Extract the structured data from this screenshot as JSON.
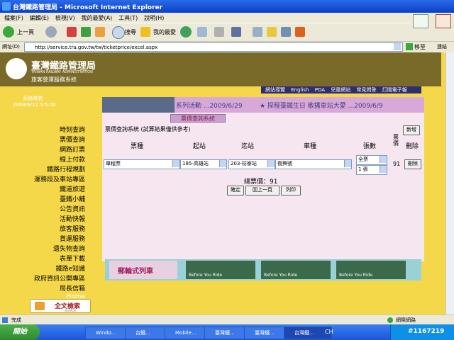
{
  "window": {
    "title": "台灣鐵路管理局 - Microsoft Internet Explorer"
  },
  "menu": [
    "檔案(F)",
    "編輯(E)",
    "檢視(V)",
    "我的最愛(A)",
    "工具(T)",
    "說明(H)"
  ],
  "toolbar": {
    "back": "上一頁",
    "search": "搜尋",
    "favorites": "我的最愛"
  },
  "address": {
    "label": "網址(D)",
    "url": "http://service.tra.gov.tw/tw/ticketprice/excel.aspx",
    "go": "移至",
    "links": "連結"
  },
  "site": {
    "logo_title": "臺灣鐵路管理局",
    "logo_subtitle": "TAIWAN RAILWAY ADMINISTRATION",
    "system_name": "旅客營運服務系統",
    "date_label": "系統時間",
    "date_value": "2009/6/12 5:5:00",
    "topnav": [
      "網站導覽",
      "English",
      "PDA",
      "兒童網站",
      "常見問答",
      "訂閱電子報"
    ]
  },
  "sidebar": [
    "時刻查詢",
    "票價查詢",
    "網路訂票",
    "線上付款",
    "鐵路行程規劃",
    "運務段及車站專區",
    "鐵道旅遊",
    "臺鐵小舖",
    "公告資訊",
    "活動快報",
    "旅客服務",
    "貨運服務",
    "遺失物查詢",
    "表單下載",
    "鐵路e知識",
    "政府資訊公開專區",
    "局長信箱",
    "Home"
  ],
  "search_button": {
    "label": "全文檢索",
    "sub": "SEARCH"
  },
  "banner": {
    "item1": "系列活動 ...2009/6/29",
    "item2": "★ 探程臺鐵生日 散播車站大愛 ...2009/6/9"
  },
  "form": {
    "tab": "票價查詢系統",
    "subtitle": "票價查詢系統 (試算結果僅供參考)",
    "new_button": "新增",
    "headers": [
      "票種",
      "起站",
      "迄站",
      "車種",
      "張數",
      "票價",
      "刪除"
    ],
    "row": {
      "ticket_type": "單程票",
      "from": "185-高雄站",
      "to": "203-枋寮站",
      "train": "復興號",
      "qty_type": "全票",
      "qty": "1 張",
      "price": "91",
      "delete": "刪除"
    },
    "total": "總票價：91",
    "buttons": [
      "確定",
      "回上一頁",
      "列印"
    ]
  },
  "promo": {
    "label": "郵輪式列車",
    "panels": [
      "Before You Ride",
      "Before You Ride",
      "Before You Ride"
    ]
  },
  "status": {
    "left": "完成",
    "right": "網際網路"
  },
  "taskbar": {
    "start": "開始",
    "tasks": [
      "Windo...",
      "台鐵...",
      "Mobile...",
      "臺灣鐵...",
      "臺灣鐵...",
      "台灣鐵..."
    ],
    "watermark": "#1167219",
    "lang": "CH"
  }
}
